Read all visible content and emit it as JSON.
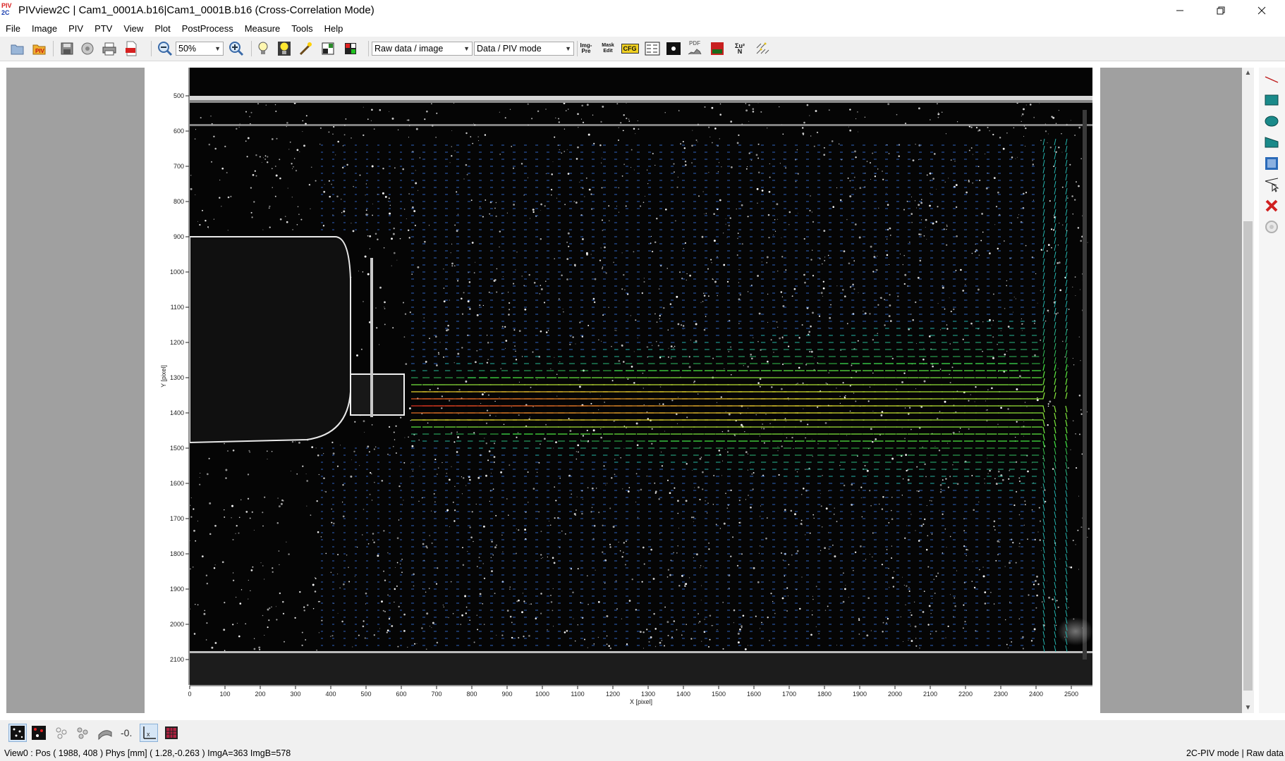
{
  "window": {
    "title": "PIVview2C | Cam1_0001A.b16|Cam1_0001B.b16 (Cross-Correlation Mode)",
    "logo_line1": "PIV",
    "logo_line2": "2C"
  },
  "menu": [
    "File",
    "Image",
    "PIV",
    "PTV",
    "View",
    "Plot",
    "PostProcess",
    "Measure",
    "Tools",
    "Help"
  ],
  "toolbar": {
    "zoom_value": "50%",
    "display_mode": "Raw data / image",
    "data_mode": "Data / PIV mode",
    "img_pre_label_1": "Img-",
    "img_pre_label_2": "Pre",
    "mask_edit_label_1": "Mask",
    "mask_edit_label_2": "Edit",
    "cfg_label": "CFG",
    "pdf_label": "PDF",
    "sum_label_1": "Σu²",
    "sum_label_2": "N"
  },
  "plot": {
    "x_axis_label": "X [pixel]",
    "y_axis_label": "Y [pixel]",
    "x_ticks": [
      "0",
      "100",
      "200",
      "300",
      "400",
      "500",
      "600",
      "700",
      "800",
      "900",
      "1000",
      "1100",
      "1200",
      "1300",
      "1400",
      "1500",
      "1600",
      "1700",
      "1800",
      "1900",
      "2000",
      "2100",
      "2200",
      "2300",
      "2400",
      "2500"
    ],
    "y_ticks": [
      "500",
      "600",
      "700",
      "800",
      "900",
      "1000",
      "1100",
      "1200",
      "1300",
      "1400",
      "1500",
      "1600",
      "1700",
      "1800",
      "1900",
      "2000",
      "2100"
    ],
    "colors": {
      "background": "#000000",
      "vector_slow": "#3c50d0",
      "vector_mid": "#22c0e0",
      "vector_fast_green": "#40e040",
      "vector_fast_yellow": "#e8e030",
      "vector_core_red": "#e03020"
    }
  },
  "status": {
    "left": "View0 : Pos ( 1988, 408 )  Phys [mm] ( 1.28,-0.263 )  ImgA=363  ImgB=578",
    "right": "2C-PIV mode | Raw data"
  }
}
